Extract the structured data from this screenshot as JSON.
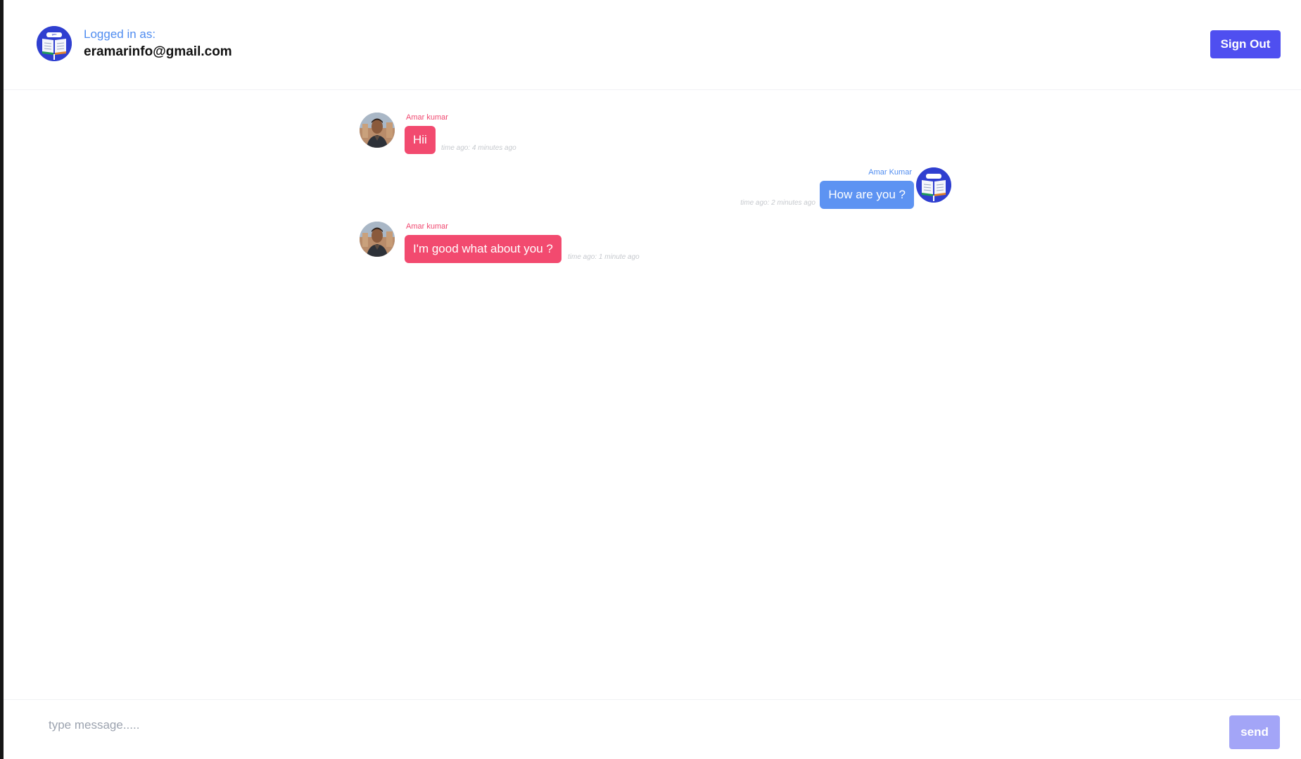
{
  "header": {
    "logged_label": "Logged in as:",
    "email": "eramarinfo@gmail.com",
    "signout_label": "Sign Out",
    "avatar_icon": "book-avatar-icon"
  },
  "messages": [
    {
      "sender": "Amar kumar",
      "text": "Hii",
      "time": "time ago: 4 minutes ago",
      "side": "left",
      "color": "#f24a6f"
    },
    {
      "sender": "Amar Kumar",
      "text": "How are you ?",
      "time": "time ago: 2 minutes ago",
      "side": "right",
      "color": "#5d93f2"
    },
    {
      "sender": "Amar kumar",
      "text": "I'm good what about you ?",
      "time": "time ago: 1 minute ago",
      "side": "left",
      "color": "#f24a6f"
    }
  ],
  "composer": {
    "placeholder": "type message.....",
    "value": "",
    "send_label": "send"
  },
  "colors": {
    "accent": "#4f4ff0",
    "incoming_bubble": "#f24a6f",
    "outgoing_bubble": "#5d93f2",
    "send_disabled": "#a3a5f7"
  }
}
